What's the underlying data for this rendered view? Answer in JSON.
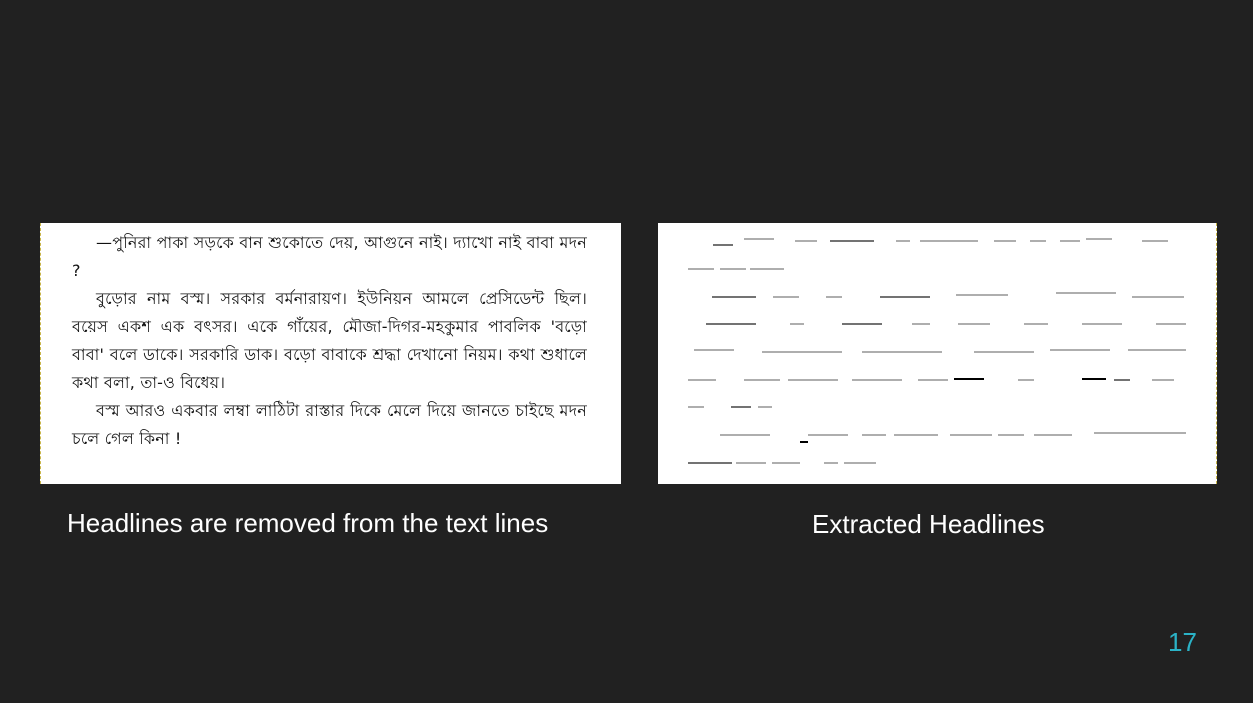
{
  "left_image": {
    "paragraphs": [
      "—পুনিরা পাকা সড়কে বান শুকোতে দেয়, আগুনে নাই। দ্যাখো নাই বাবা মদন ?",
      "বুড়োর নাম বস্ম। সরকার বর্মনারায়ণ। ইউনিয়ন আমলে প্রেসিডেন্ট ছিল। বয়েস একশ এক বৎসর। একে গাঁয়ের, মৌজা-দিগর-মহকুমার পাবলিক 'বড়ো বাবা' বলে ডাকে। সরকারি ডাক। বড়ো বাবাকে শ্রদ্ধা দেখানো নিয়ম। কথা শুধালে কথা বলা, তা-ও বিধেয়।",
      "বস্ম আরও একবার লম্বা লাঠিটা রাস্তার দিকে মেলে দিয়ে জানতে চাইছে মদন চলে গেল কিনা !"
    ]
  },
  "captions": {
    "left": "Headlines are removed from the text lines",
    "right": "Extracted Headlines"
  },
  "slide_number": "17",
  "colors": {
    "background": "#212121",
    "caption": "#ffffff",
    "slide_number": "#2bb3c7"
  }
}
